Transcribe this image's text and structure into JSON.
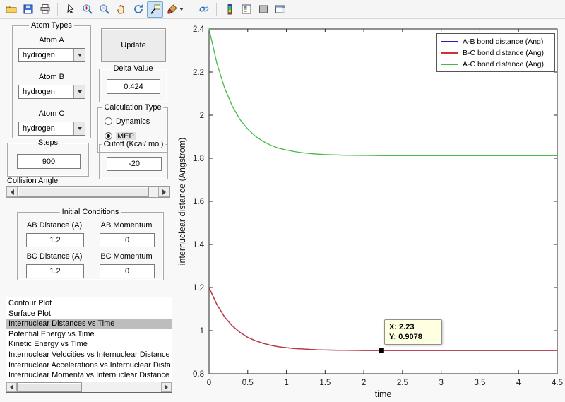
{
  "toolbar": {
    "icons": [
      "open-file",
      "save",
      "print",
      "edit-plot",
      "zoom-in",
      "zoom-out",
      "pan",
      "rotate-3d",
      "data-cursor",
      "brush",
      "link-plot",
      "insert-colorbar",
      "insert-legend",
      "hide-plot-tools",
      "show-plot-tools"
    ],
    "active_tool": "data-cursor"
  },
  "controls": {
    "atom_types": {
      "title": "Atom Types",
      "atoms": [
        {
          "label": "Atom A",
          "value": "hydrogen"
        },
        {
          "label": "Atom B",
          "value": "hydrogen"
        },
        {
          "label": "Atom C",
          "value": "hydrogen"
        }
      ]
    },
    "update_button": {
      "label": "Update"
    },
    "delta_value": {
      "title": "Delta Value",
      "value": "0.424"
    },
    "calculation_type": {
      "title": "Calculation Type",
      "options": [
        {
          "label": "Dynamics",
          "selected": false
        },
        {
          "label": "MEP",
          "selected": true
        }
      ]
    },
    "steps": {
      "title": "Steps",
      "value": "900"
    },
    "cutoff": {
      "title": "Cutoff (Kcal/ mol)",
      "value": "-20"
    },
    "collision_angle": {
      "label": "Collision Angle"
    },
    "initial_conditions": {
      "title": "Initial Conditions",
      "fields": [
        {
          "label": "AB Distance (A)",
          "value": "1.2"
        },
        {
          "label": "AB Momentum",
          "value": "0"
        },
        {
          "label": "BC Distance (A)",
          "value": "1.2"
        },
        {
          "label": "BC Momentum",
          "value": "0"
        }
      ]
    },
    "plot_list": {
      "items": [
        "Contour Plot",
        "Surface Plot",
        "Internuclear Distances vs Time",
        "Potential Energy vs Time",
        "Kinetic Energy vs Time",
        "Internuclear Velocities vs Internuclear Distance",
        "Internuclear Accelerations vs Internuclear Dista",
        "Internuclear Momenta vs Internuclear Distance"
      ],
      "selected_index": 2
    }
  },
  "chart_data": {
    "type": "line",
    "title": "",
    "xlabel": "time",
    "ylabel": "internuclear distance (Angstrom)",
    "xlim": [
      0,
      4.5
    ],
    "ylim": [
      0.8,
      2.4
    ],
    "xticks": [
      0,
      0.5,
      1,
      1.5,
      2,
      2.5,
      3,
      3.5,
      4,
      4.5
    ],
    "yticks": [
      0.8,
      1,
      1.2,
      1.4,
      1.6,
      1.8,
      2,
      2.2,
      2.4
    ],
    "grid": false,
    "legend_position": "top-right",
    "x": [
      0,
      0.1,
      0.2,
      0.3,
      0.4,
      0.5,
      0.6,
      0.7,
      0.8,
      0.9,
      1.0,
      1.1,
      1.2,
      1.3,
      1.4,
      1.5,
      1.75,
      2.0,
      2.25,
      2.5,
      3.0,
      3.5,
      4.0,
      4.5
    ],
    "series": [
      {
        "name": "A-B bond distance (Ang)",
        "color": "#2222bb",
        "values": [
          1.2,
          1.122,
          1.064,
          1.022,
          0.992,
          0.969,
          0.953,
          0.941,
          0.932,
          0.925,
          0.921,
          0.917,
          0.915,
          0.913,
          0.911,
          0.91,
          0.909,
          0.908,
          0.908,
          0.908,
          0.908,
          0.908,
          0.908,
          0.908
        ]
      },
      {
        "name": "B-C bond distance (Ang)",
        "color": "#cc3333",
        "values": [
          1.2,
          1.122,
          1.064,
          1.022,
          0.992,
          0.969,
          0.953,
          0.941,
          0.932,
          0.925,
          0.921,
          0.917,
          0.915,
          0.913,
          0.911,
          0.91,
          0.909,
          0.908,
          0.908,
          0.908,
          0.908,
          0.908,
          0.908,
          0.908
        ]
      },
      {
        "name": "A-C bond distance (Ang)",
        "color": "#44bb44",
        "values": [
          2.4,
          2.242,
          2.127,
          2.042,
          1.98,
          1.935,
          1.902,
          1.878,
          1.86,
          1.847,
          1.838,
          1.831,
          1.826,
          1.822,
          1.819,
          1.817,
          1.814,
          1.813,
          1.812,
          1.812,
          1.812,
          1.812,
          1.812,
          1.812
        ]
      }
    ],
    "datatip": {
      "x": 2.23,
      "y": 0.9078,
      "label_x": "X: 2.23",
      "label_y": "Y: 0.9078"
    }
  }
}
